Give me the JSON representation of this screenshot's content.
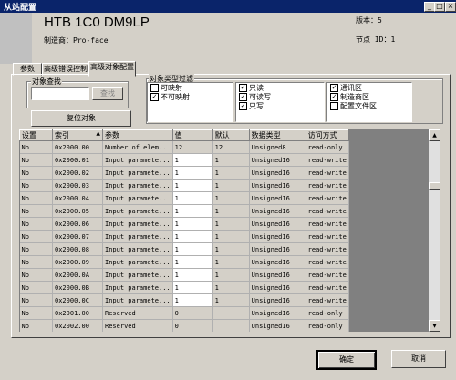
{
  "window": {
    "title": "从站配置"
  },
  "title_controls": {
    "minimize": "_",
    "maximize": "□",
    "close": "×"
  },
  "device": {
    "model": "HTB 1C0 DM9LP",
    "manufacturer": "制造商：Pro-face",
    "version": "版本：5",
    "node_id": "节点 ID：1"
  },
  "tabs": [
    {
      "label": "参数"
    },
    {
      "label": "高级错误控制"
    },
    {
      "label": "高级对象配置"
    }
  ],
  "search": {
    "group_label": "对象查找",
    "input_value": "",
    "button_label": "查找"
  },
  "reset_button": "复位对象",
  "filter": {
    "group_label": "对象类型过滤",
    "list1": [
      {
        "label": "可映射",
        "checked": false
      },
      {
        "label": "不可映射",
        "checked": true
      }
    ],
    "list2": [
      {
        "label": "只读",
        "checked": true
      },
      {
        "label": "可读写",
        "checked": true
      },
      {
        "label": "只写",
        "checked": true
      }
    ],
    "list3": [
      {
        "label": "通讯区",
        "checked": true
      },
      {
        "label": "制造商区",
        "checked": true
      },
      {
        "label": "配置文件区",
        "checked": false
      }
    ]
  },
  "table": {
    "columns": [
      "设置",
      "索引",
      "参数",
      "值",
      "默认",
      "数据类型",
      "访问方式"
    ],
    "sort_indicator": "▲",
    "rows": [
      [
        "No",
        "0x2000.00",
        "Number of elem...",
        "12",
        "12",
        "Unsigned8",
        "read-only"
      ],
      [
        "No",
        "0x2000.01",
        "Input paramete...",
        "1",
        "1",
        "Unsigned16",
        "read-write"
      ],
      [
        "No",
        "0x2000.02",
        "Input paramete...",
        "1",
        "1",
        "Unsigned16",
        "read-write"
      ],
      [
        "No",
        "0x2000.03",
        "Input paramete...",
        "1",
        "1",
        "Unsigned16",
        "read-write"
      ],
      [
        "No",
        "0x2000.04",
        "Input paramete...",
        "1",
        "1",
        "Unsigned16",
        "read-write"
      ],
      [
        "No",
        "0x2000.05",
        "Input paramete...",
        "1",
        "1",
        "Unsigned16",
        "read-write"
      ],
      [
        "No",
        "0x2000.06",
        "Input paramete...",
        "1",
        "1",
        "Unsigned16",
        "read-write"
      ],
      [
        "No",
        "0x2000.07",
        "Input paramete...",
        "1",
        "1",
        "Unsigned16",
        "read-write"
      ],
      [
        "No",
        "0x2000.08",
        "Input paramete...",
        "1",
        "1",
        "Unsigned16",
        "read-write"
      ],
      [
        "No",
        "0x2000.09",
        "Input paramete...",
        "1",
        "1",
        "Unsigned16",
        "read-write"
      ],
      [
        "No",
        "0x2000.0A",
        "Input paramete...",
        "1",
        "1",
        "Unsigned16",
        "read-write"
      ],
      [
        "No",
        "0x2000.0B",
        "Input paramete...",
        "1",
        "1",
        "Unsigned16",
        "read-write"
      ],
      [
        "No",
        "0x2000.0C",
        "Input paramete...",
        "1",
        "1",
        "Unsigned16",
        "read-write"
      ],
      [
        "No",
        "0x2001.00",
        "Reserved",
        "0",
        "",
        "Unsigned16",
        "read-only"
      ],
      [
        "No",
        "0x2002.00",
        "Reserved",
        "0",
        "",
        "Unsigned16",
        "read-only"
      ]
    ]
  },
  "footer": {
    "ok": "确定",
    "cancel": "取消"
  }
}
